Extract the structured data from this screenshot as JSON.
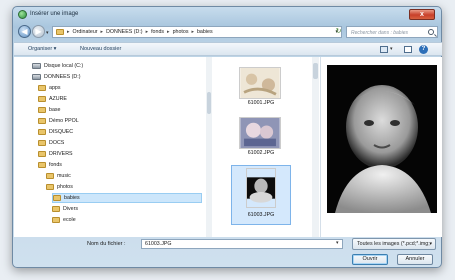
{
  "window": {
    "title": "Insérer une image",
    "close": "x"
  },
  "nav": {
    "back": "◀",
    "forward": "▶",
    "history": "▾",
    "breadcrumb": [
      "Ordinateur",
      "DONNEES (D:)",
      "fonds",
      "photos",
      "babies"
    ],
    "separator": "▸",
    "address_dropdown": "▾",
    "refresh": "↻",
    "search_placeholder": "Rechercher dans : babies"
  },
  "toolbar": {
    "organize": "Organiser ▾",
    "new_folder": "Nouveau dossier",
    "view_dropdown": "▾",
    "help": "?"
  },
  "tree": {
    "items": [
      {
        "label": "Disque local (C:)",
        "icon": "drive-icon"
      },
      {
        "label": "DONNEES (D:)",
        "icon": "drive-icon"
      },
      {
        "label": "apps",
        "icon": "folder-icon"
      },
      {
        "label": "AZURE",
        "icon": "folder-icon"
      },
      {
        "label": "base",
        "icon": "folder-icon"
      },
      {
        "label": "Démo PPOL",
        "icon": "folder-icon"
      },
      {
        "label": "DISQUEC",
        "icon": "folder-icon"
      },
      {
        "label": "DOCS",
        "icon": "folder-icon"
      },
      {
        "label": "DRIVERS",
        "icon": "folder-icon"
      },
      {
        "label": "fonds",
        "icon": "folder-icon"
      },
      {
        "label": "music",
        "icon": "folder-icon"
      },
      {
        "label": "photos",
        "icon": "folder-icon"
      },
      {
        "label": "babies",
        "icon": "folder-icon",
        "selected": true
      },
      {
        "label": "Divers",
        "icon": "folder-icon"
      },
      {
        "label": "ecole",
        "icon": "folder-icon"
      }
    ]
  },
  "files": [
    {
      "name": "61001.JPG"
    },
    {
      "name": "61002.JPG"
    },
    {
      "name": "61003.JPG",
      "selected": true
    }
  ],
  "footer": {
    "filename_label": "Nom du fichier :",
    "filename_value": "61003.JPG",
    "filename_dropdown": "▾",
    "filetype": "Toutes les images (*.pcd;*.img;",
    "filetype_arrow": "▾",
    "open": "Ouvrir",
    "cancel": "Annuler"
  },
  "colors": {
    "selection": "#cce6fb",
    "close": "#c8402a",
    "folder": "#e9c56a"
  }
}
